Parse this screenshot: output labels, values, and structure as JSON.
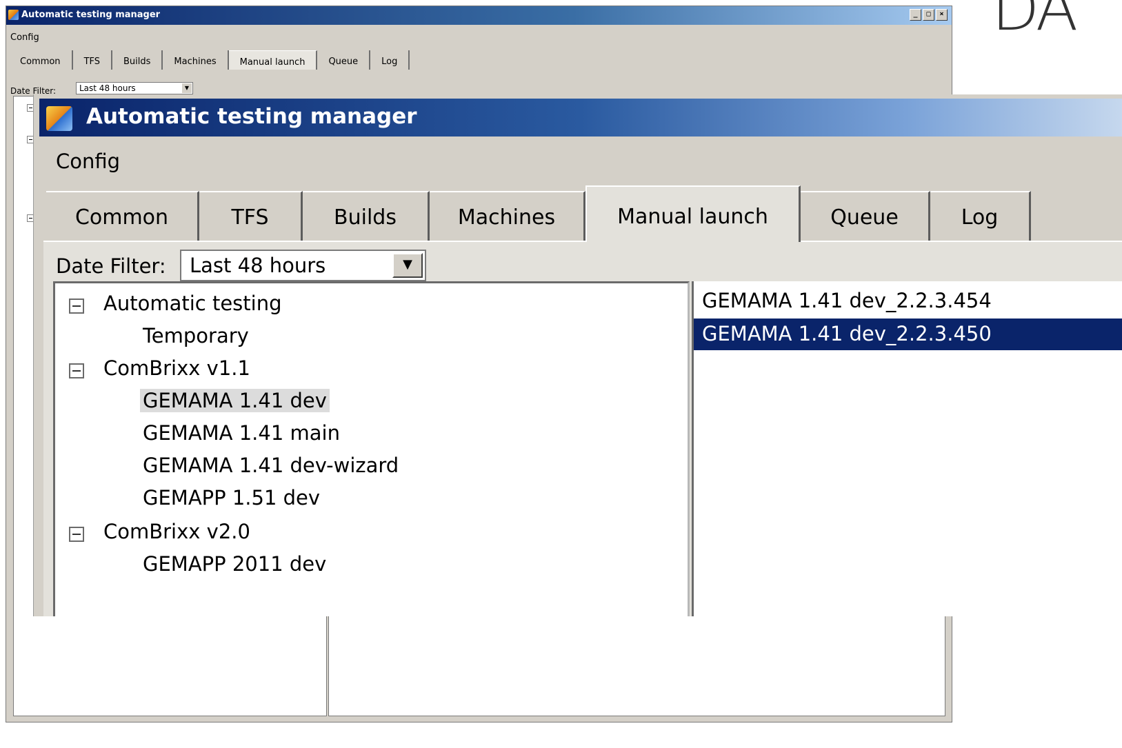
{
  "window_title": "Automatic testing manager",
  "menu": {
    "config": "Config"
  },
  "tabs": [
    "Common",
    "TFS",
    "Builds",
    "Machines",
    "Manual launch",
    "Queue",
    "Log"
  ],
  "active_tab": "Manual launch",
  "date_filter": {
    "label": "Date Filter:",
    "value": "Last 48 hours"
  },
  "tree": [
    {
      "label": "Automatic testing",
      "expanded": true,
      "children": [
        "Temporary"
      ]
    },
    {
      "label": "ComBrixx v1.1",
      "expanded": true,
      "children": [
        "GEMAMA 1.41 dev",
        "GEMAMA 1.41 main",
        "GEMAMA 1.41 dev-wizard",
        "GEMAPP 1.51 dev"
      ]
    },
    {
      "label": "ComBrixx v2.0",
      "expanded": true,
      "children": [
        "GEMAPP 2011 dev"
      ]
    }
  ],
  "selected_tree_item": "GEMAMA 1.41 dev",
  "builds": [
    "GEMAMA 1.41 dev_2.2.3.454",
    "GEMAMA 1.41 dev_2.2.3.450"
  ],
  "selected_build": "GEMAMA 1.41 dev_2.2.3.450",
  "window_controls": {
    "minimize": "_",
    "maximize": "□",
    "close": "×"
  },
  "colors": {
    "title_bar": "#0a246a",
    "selection": "#0a246a",
    "window_bg": "#d4d0c8"
  }
}
